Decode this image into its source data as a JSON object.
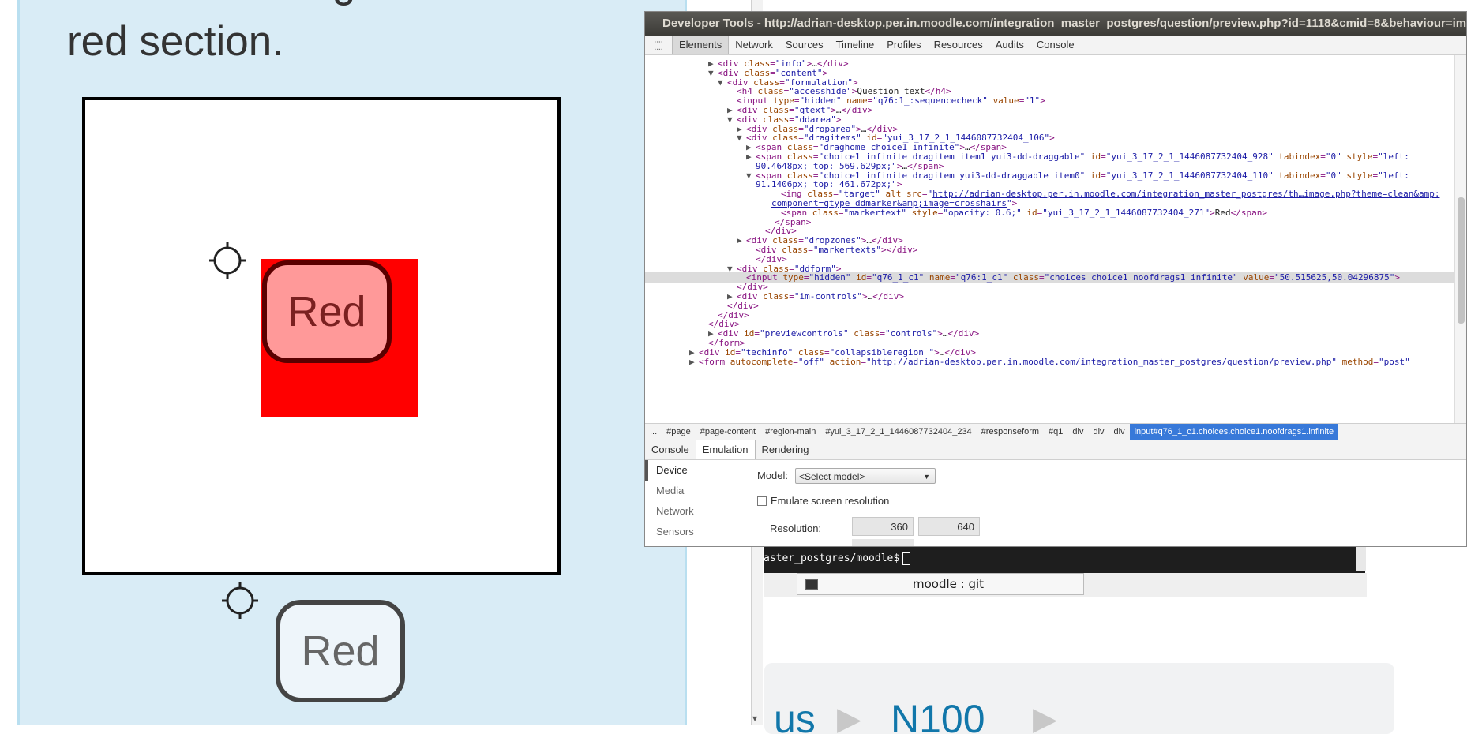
{
  "question": {
    "text_top": "Move the triangle to the",
    "text": "red section."
  },
  "markers": {
    "dropped_label": "Red",
    "home_label": "Red"
  },
  "devtools": {
    "title": "Developer Tools - http://adrian-desktop.per.in.moodle.com/integration_master_postgres/question/preview.php?id=1118&cmid=8&behaviour=im",
    "tabs": [
      "Elements",
      "Network",
      "Sources",
      "Timeline",
      "Profiles",
      "Resources",
      "Audits",
      "Console"
    ],
    "active_tab": "Elements",
    "breadcrumbs": [
      "...",
      "#page",
      "#page-content",
      "#region-main",
      "#yui_3_17_2_1_1446087732404_234",
      "#responseform",
      "#q1",
      "div",
      "div",
      "div",
      "input#q76_1_c1.choices.choice1.noofdrags1.infinite"
    ],
    "drawer_tabs": [
      "Console",
      "Emulation",
      "Rendering"
    ],
    "active_drawer_tab": "Emulation",
    "emulation_nav": [
      "Device",
      "Media",
      "Network",
      "Sensors"
    ],
    "active_emulation_nav": "Device",
    "model_label": "Model:",
    "model_value": "<Select model>",
    "emulate_label": "Emulate screen resolution",
    "resolution_label": "Resolution:",
    "resolution_width": "360",
    "resolution_height": "640",
    "dom_lines": [
      {
        "t": "closed",
        "html": "<span class='tag'>&lt;div</span> <span class='attr'>class</span>=<span class='val'>\"info\"</span><span class='tag'>&gt;</span><span class='txt'>…</span><span class='tag'>&lt;/div&gt;</span>"
      },
      {
        "t": "open",
        "html": "<span class='tag'>&lt;div</span> <span class='attr'>class</span>=<span class='val'>\"content\"</span><span class='tag'>&gt;</span>"
      },
      {
        "t": "open",
        "html": "<span class='tag'>&lt;div</span> <span class='attr'>class</span>=<span class='val'>\"formulation\"</span><span class='tag'>&gt;</span>"
      },
      {
        "t": "none",
        "html": "<span class='tag'>&lt;h4</span> <span class='attr'>class</span>=<span class='val'>\"accesshide\"</span><span class='tag'>&gt;</span><span class='txt'>Question text</span><span class='tag'>&lt;/h4&gt;</span>"
      },
      {
        "t": "none",
        "html": "<span class='tag'>&lt;input</span> <span class='attr'>type</span>=<span class='val'>\"hidden\"</span> <span class='attr'>name</span>=<span class='val'>\"q76:1_:sequencecheck\"</span> <span class='attr'>value</span>=<span class='val'>\"1\"</span><span class='tag'>&gt;</span>"
      },
      {
        "t": "closed",
        "html": "<span class='tag'>&lt;div</span> <span class='attr'>class</span>=<span class='val'>\"qtext\"</span><span class='tag'>&gt;</span><span class='txt'>…</span><span class='tag'>&lt;/div&gt;</span>"
      },
      {
        "t": "open",
        "html": "<span class='tag'>&lt;div</span> <span class='attr'>class</span>=<span class='val'>\"ddarea\"</span><span class='tag'>&gt;</span>"
      },
      {
        "t": "closed",
        "html": "<span class='tag'>&lt;div</span> <span class='attr'>class</span>=<span class='val'>\"droparea\"</span><span class='tag'>&gt;</span><span class='txt'>…</span><span class='tag'>&lt;/div&gt;</span>"
      },
      {
        "t": "open",
        "html": "<span class='tag'>&lt;div</span> <span class='attr'>class</span>=<span class='val'>\"dragitems\"</span> <span class='attr'>id</span>=<span class='val'>\"yui_3_17_2_1_1446087732404_106\"</span><span class='tag'>&gt;</span>"
      },
      {
        "t": "closed",
        "html": "<span class='tag'>&lt;span</span> <span class='attr'>class</span>=<span class='val'>\"draghome choice1 infinite\"</span><span class='tag'>&gt;</span><span class='txt'>…</span><span class='tag'>&lt;/span&gt;</span>"
      },
      {
        "t": "closed",
        "html": "<span class='tag'>&lt;span</span> <span class='attr'>class</span>=<span class='val'>\"choice1 infinite dragitem item1 yui3-dd-draggable\"</span> <span class='attr'>id</span>=<span class='val'>\"yui_3_17_2_1_1446087732404_928\"</span> <span class='attr'>tabindex</span>=<span class='val'>\"0\"</span> <span class='attr'>style</span>=<span class='val'>\"left:</span>"
      },
      {
        "t": "cont",
        "html": "<span class='val'>90.4648px; top: 569.629px;\"</span><span class='tag'>&gt;</span><span class='txt'>…</span><span class='tag'>&lt;/span&gt;</span>"
      },
      {
        "t": "open",
        "html": "<span class='tag'>&lt;span</span> <span class='attr'>class</span>=<span class='val'>\"choice1 infinite dragitem yui3-dd-draggable item0\"</span> <span class='attr'>id</span>=<span class='val'>\"yui_3_17_2_1_1446087732404_110\"</span> <span class='attr'>tabindex</span>=<span class='val'>\"0\"</span> <span class='attr'>style</span>=<span class='val'>\"left:</span>"
      },
      {
        "t": "cont",
        "html": "<span class='val'>91.1406px; top: 461.672px;\"</span><span class='tag'>&gt;</span>"
      },
      {
        "t": "none",
        "html": "<span class='tag'>&lt;img</span> <span class='attr'>class</span>=<span class='val'>\"target\"</span> <span class='attr'>alt src</span>=<span class='val'>\"<span class='link'>http://adrian-desktop.per.in.moodle.com/integration_master_postgres/th…image.php?theme=clean&amp;amp;</span></span>"
      },
      {
        "t": "cont",
        "html": "<span class='link'>component=qtype_ddmarker&amp;amp;image=crosshairs</span><span class='val'>\"</span><span class='tag'>&gt;</span>"
      },
      {
        "t": "none",
        "html": "<span class='tag'>&lt;span</span> <span class='attr'>class</span>=<span class='val'>\"markertext\"</span> <span class='attr'>style</span>=<span class='val'>\"opacity: 0.6;\"</span> <span class='attr'>id</span>=<span class='val'>\"yui_3_17_2_1_1446087732404_271\"</span><span class='tag'>&gt;</span><span class='txt'>Red</span><span class='tag'>&lt;/span&gt;</span>"
      },
      {
        "t": "none",
        "html": "<span class='tag'>&lt;/span&gt;</span>"
      },
      {
        "t": "none",
        "html": "<span class='tag'>&lt;/div&gt;</span>"
      },
      {
        "t": "closed",
        "html": "<span class='tag'>&lt;div</span> <span class='attr'>class</span>=<span class='val'>\"dropzones\"</span><span class='tag'>&gt;</span><span class='txt'>…</span><span class='tag'>&lt;/div&gt;</span>"
      },
      {
        "t": "none",
        "html": "<span class='tag'>&lt;div</span> <span class='attr'>class</span>=<span class='val'>\"markertexts\"</span><span class='tag'>&gt;&lt;/div&gt;</span>"
      },
      {
        "t": "none",
        "html": "<span class='tag'>&lt;/div&gt;</span>"
      },
      {
        "t": "open",
        "html": "<span class='tag'>&lt;div</span> <span class='attr'>class</span>=<span class='val'>\"ddform\"</span><span class='tag'>&gt;</span>"
      },
      {
        "t": "none",
        "html": "<span class='tag'>&lt;input</span> <span class='attr'>type</span>=<span class='val'>\"hidden\"</span> <span class='attr'>id</span>=<span class='val'>\"q76_1_c1\"</span> <span class='attr'>name</span>=<span class='val'>\"q76:1_c1\"</span> <span class='attr'>class</span>=<span class='val'>\"choices choice1 noofdrags1 infinite\"</span> <span class='attr'>value</span>=<span class='val'>\"50.515625,50.04296875\"</span><span class='tag'>&gt;</span>",
        "selected": true
      },
      {
        "t": "none",
        "html": "<span class='tag'>&lt;/div&gt;</span>"
      },
      {
        "t": "closed",
        "html": "<span class='tag'>&lt;div</span> <span class='attr'>class</span>=<span class='val'>\"im-controls\"</span><span class='tag'>&gt;</span><span class='txt'>…</span><span class='tag'>&lt;/div&gt;</span>"
      },
      {
        "t": "none",
        "html": "<span class='tag'>&lt;/div&gt;</span>"
      },
      {
        "t": "none",
        "html": "<span class='tag'>&lt;/div&gt;</span>"
      },
      {
        "t": "none",
        "html": "<span class='tag'>&lt;/div&gt;</span>"
      },
      {
        "t": "closed",
        "html": "<span class='tag'>&lt;div</span> <span class='attr'>id</span>=<span class='val'>\"previewcontrols\"</span> <span class='attr'>class</span>=<span class='val'>\"controls\"</span><span class='tag'>&gt;</span><span class='txt'>…</span><span class='tag'>&lt;/div&gt;</span>"
      },
      {
        "t": "none",
        "html": "<span class='tag'>&lt;/form&gt;</span>"
      },
      {
        "t": "closed",
        "html": "<span class='tag'>&lt;div</span> <span class='attr'>id</span>=<span class='val'>\"techinfo\"</span> <span class='attr'>class</span>=<span class='val'>\"collapsibleregion \"</span><span class='tag'>&gt;</span><span class='txt'>…</span><span class='tag'>&lt;/div&gt;</span>"
      },
      {
        "t": "closed",
        "html": "<span class='tag'>&lt;form</span> <span class='attr'>autocomplete</span>=<span class='val'>\"off\"</span> <span class='attr'>action</span>=<span class='val'>\"http://adrian-desktop.per.in.moodle.com/integration_master_postgres/question/preview.php\"</span> <span class='attr'>method</span>=<span class='val'>\"post\"</span>"
      }
    ]
  },
  "terminal": {
    "prompt": "aster_postgres/moodle$"
  },
  "taskbar": {
    "item_label": "moodle : git"
  },
  "background_page": {
    "crumb_1": "us",
    "crumb_2": "N100"
  }
}
